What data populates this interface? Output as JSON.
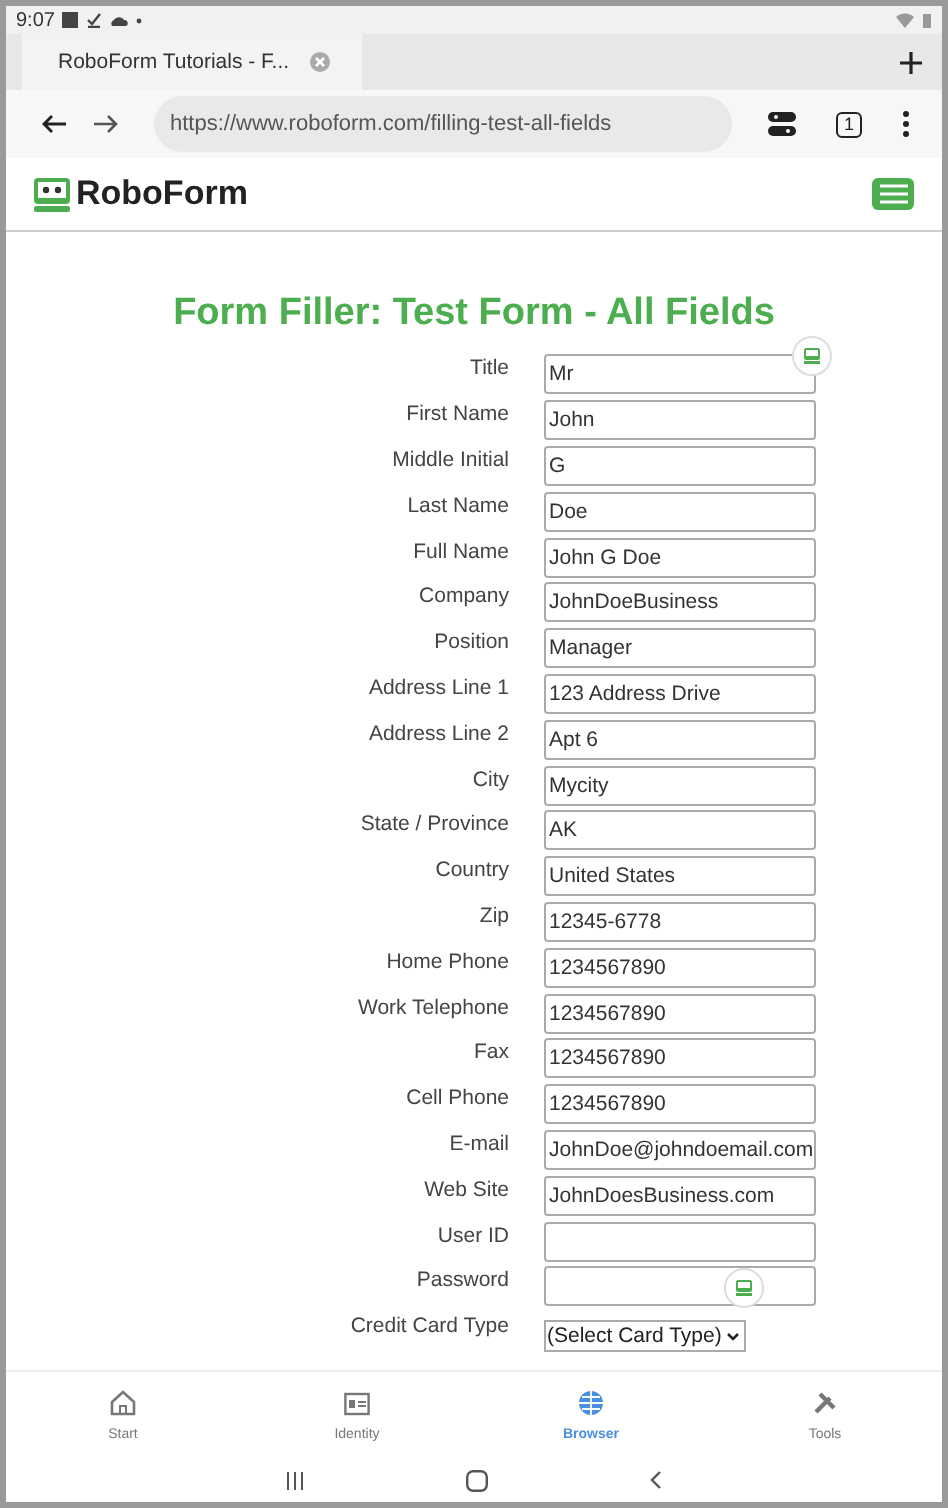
{
  "status_bar": {
    "time": "9:07"
  },
  "browser_tab": {
    "title": "RoboForm Tutorials - F..."
  },
  "address_bar": {
    "url": "https://www.roboform.com/filling-test-all-fields",
    "tab_count": "1"
  },
  "site_header": {
    "logo": "RoboForm"
  },
  "page": {
    "heading": "Form Filler: Test Form - All Fields",
    "fields": [
      {
        "label": "Title",
        "value": "Mr",
        "kind": "text"
      },
      {
        "label": "First Name",
        "value": "John",
        "kind": "text"
      },
      {
        "label": "Middle Initial",
        "value": "G",
        "kind": "text"
      },
      {
        "label": "Last Name",
        "value": "Doe",
        "kind": "text"
      },
      {
        "label": "Full Name",
        "value": "John G Doe",
        "kind": "text"
      },
      {
        "label": "Company",
        "value": "JohnDoeBusiness",
        "kind": "text"
      },
      {
        "label": "Position",
        "value": "Manager",
        "kind": "text"
      },
      {
        "label": "Address Line 1",
        "value": "123 Address Drive",
        "kind": "text"
      },
      {
        "label": "Address Line 2",
        "value": "Apt 6",
        "kind": "text"
      },
      {
        "label": "City",
        "value": "Mycity",
        "kind": "text"
      },
      {
        "label": "State / Province",
        "value": "AK",
        "kind": "text"
      },
      {
        "label": "Country",
        "value": "United States",
        "kind": "text"
      },
      {
        "label": "Zip",
        "value": "12345-6778",
        "kind": "text"
      },
      {
        "label": "Home Phone",
        "value": "1234567890",
        "kind": "text"
      },
      {
        "label": "Work Telephone",
        "value": "1234567890",
        "kind": "text"
      },
      {
        "label": "Fax",
        "value": "1234567890",
        "kind": "text"
      },
      {
        "label": "Cell Phone",
        "value": "1234567890",
        "kind": "text"
      },
      {
        "label": "E-mail",
        "value": "JohnDoe@johndoemail.com",
        "kind": "text"
      },
      {
        "label": "Web Site",
        "value": "JohnDoesBusiness.com",
        "kind": "text"
      },
      {
        "label": "User ID",
        "kind": "text"
      },
      {
        "label": "Password",
        "kind": "text"
      },
      {
        "label": "Credit Card Type",
        "value": "(Select Card Type)",
        "kind": "select"
      }
    ]
  },
  "bottom_nav": [
    {
      "label": "Start",
      "selected": false
    },
    {
      "label": "Identity",
      "selected": false
    },
    {
      "label": "Browser",
      "selected": true
    },
    {
      "label": "Tools",
      "selected": false
    }
  ]
}
